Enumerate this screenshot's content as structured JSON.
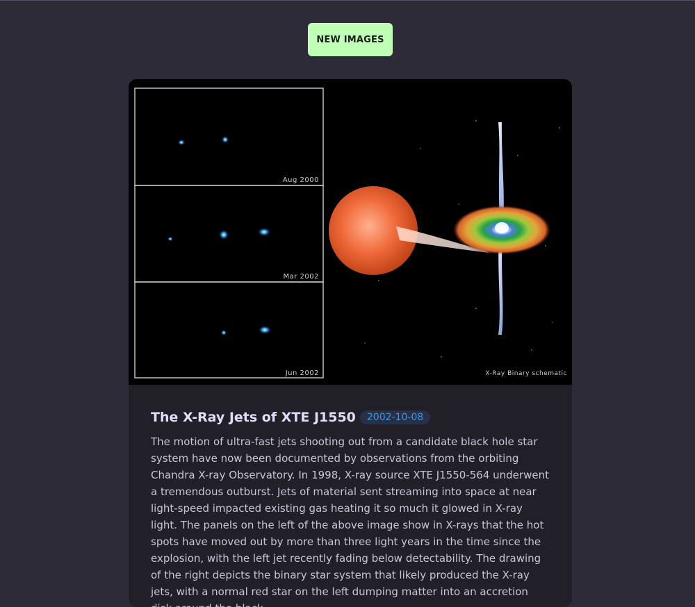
{
  "header": {
    "new_images_label": "NEW IMAGES"
  },
  "apod": {
    "title": "The X-Ray Jets of XTE J1550",
    "date": "2002-10-08",
    "explanation": "The motion of ultra-fast jets shooting out from a candidate black hole star system have now been documented by observations from the orbiting Chandra X-ray Observatory. In 1998, X-ray source XTE J1550-564 underwent a tremendous outburst. Jets of material sent streaming into space at near light-speed impacted existing gas heating it so much it glowed in X-ray light. The panels on the left of the above image show in X-rays that the hot spots have moved out by more than three light years in the time since the explosion, with the left jet recently fading below detectability. The drawing of the right depicts the binary star system that likely produced the X-ray jets, with a normal red star on the left dumping matter into an accretion disk around the black",
    "image": {
      "panel_labels": [
        "Aug 2000",
        "Mar 2002",
        "Jun 2002"
      ],
      "schematic_label": "X-Ray Binary schematic"
    }
  },
  "colors": {
    "background": "#2c2b37",
    "card": "#211f28",
    "button": "#bfffb6",
    "title": "#e3dcf6",
    "date_badge_text": "#3d98e4",
    "date_badge_bg": "#273046",
    "body_text": "#c9c6d8"
  }
}
